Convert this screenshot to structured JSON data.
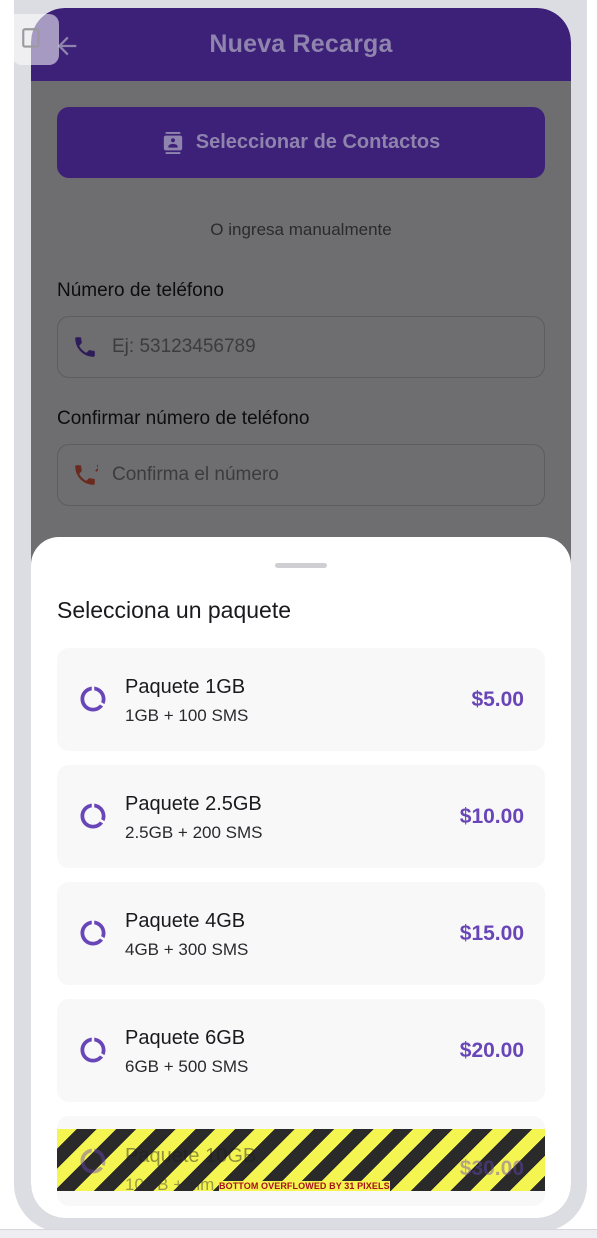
{
  "app_bar": {
    "title": "Nueva Recarga"
  },
  "contacts_button": {
    "label": "Seleccionar de Contactos"
  },
  "or_text": "O ingresa manualmente",
  "phone_field": {
    "label": "Número de teléfono",
    "placeholder": "Ej: 53123456789"
  },
  "confirm_field": {
    "label": "Confirmar número de teléfono",
    "placeholder": "Confirma el número"
  },
  "sheet": {
    "title": "Selecciona un paquete",
    "packages": [
      {
        "name": "Paquete 1GB",
        "desc": "1GB + 100 SMS",
        "price": "$5.00"
      },
      {
        "name": "Paquete 2.5GB",
        "desc": "2.5GB + 200 SMS",
        "price": "$10.00"
      },
      {
        "name": "Paquete 4GB",
        "desc": "4GB + 300 SMS",
        "price": "$15.00"
      },
      {
        "name": "Paquete 6GB",
        "desc": "6GB + 500 SMS",
        "price": "$20.00"
      },
      {
        "name": "Paquete 10GB",
        "desc": "10GB + Ilim",
        "price": "$30.00"
      }
    ],
    "overflow_warning": "BOTTOM OVERFLOWED BY 31 PIXELS"
  },
  "colors": {
    "primary": "#3d2078",
    "price": "#6946b8",
    "overlay": "#6e6e70"
  },
  "icons": [
    "arrow-back-icon",
    "contacts-icon",
    "phone-icon",
    "phone-missed-icon",
    "data-usage-icon"
  ]
}
